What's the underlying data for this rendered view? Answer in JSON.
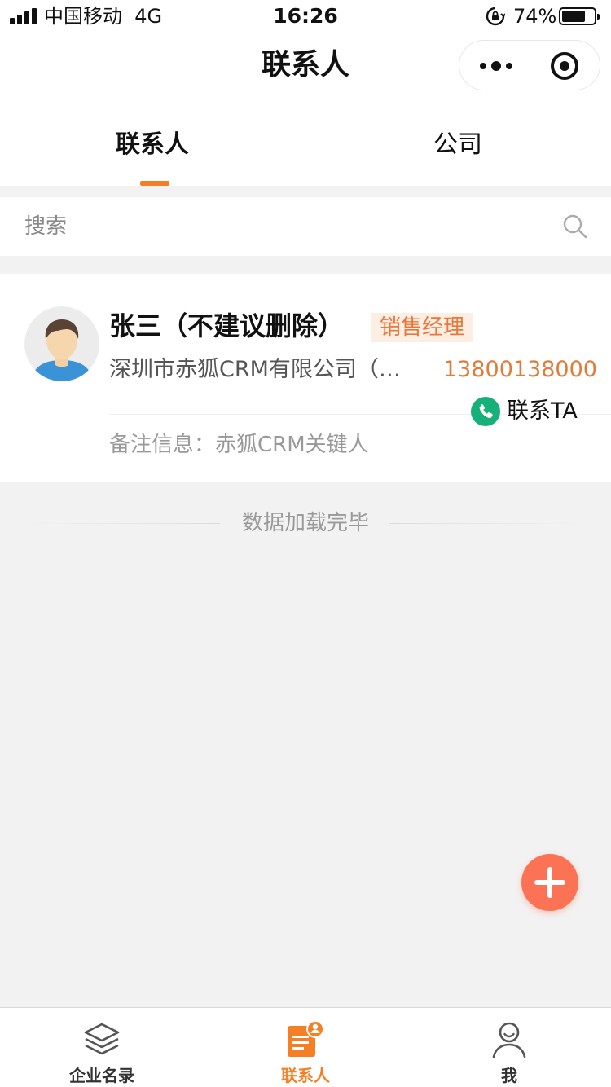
{
  "status_bar": {
    "carrier": "中国移动",
    "network": "4G",
    "time": "16:26",
    "battery": "74%",
    "battery_level": 0.74
  },
  "nav": {
    "title": "联系人"
  },
  "tabs": [
    {
      "label": "联系人",
      "active": true
    },
    {
      "label": "公司",
      "active": false
    }
  ],
  "search": {
    "placeholder": "搜索"
  },
  "contacts": [
    {
      "name": "张三（不建议删除）",
      "role": "销售经理",
      "company": "深圳市赤狐CRM有限公司（…",
      "phone": "13800138000",
      "call_label": "联系TA",
      "note": "备注信息：赤狐CRM关键人"
    }
  ],
  "list_end_text": "数据加载完毕",
  "tab_bar": [
    {
      "label": "企业名录",
      "icon": "layers-icon",
      "active": false
    },
    {
      "label": "联系人",
      "icon": "contact-card-icon",
      "active": true
    },
    {
      "label": "我",
      "icon": "user-icon",
      "active": false
    }
  ],
  "colors": {
    "accent": "#f57f25",
    "fab": "#fb7255",
    "phone": "#e07b39",
    "call_green": "#16b07a",
    "badge_bg": "#fdeee4"
  }
}
